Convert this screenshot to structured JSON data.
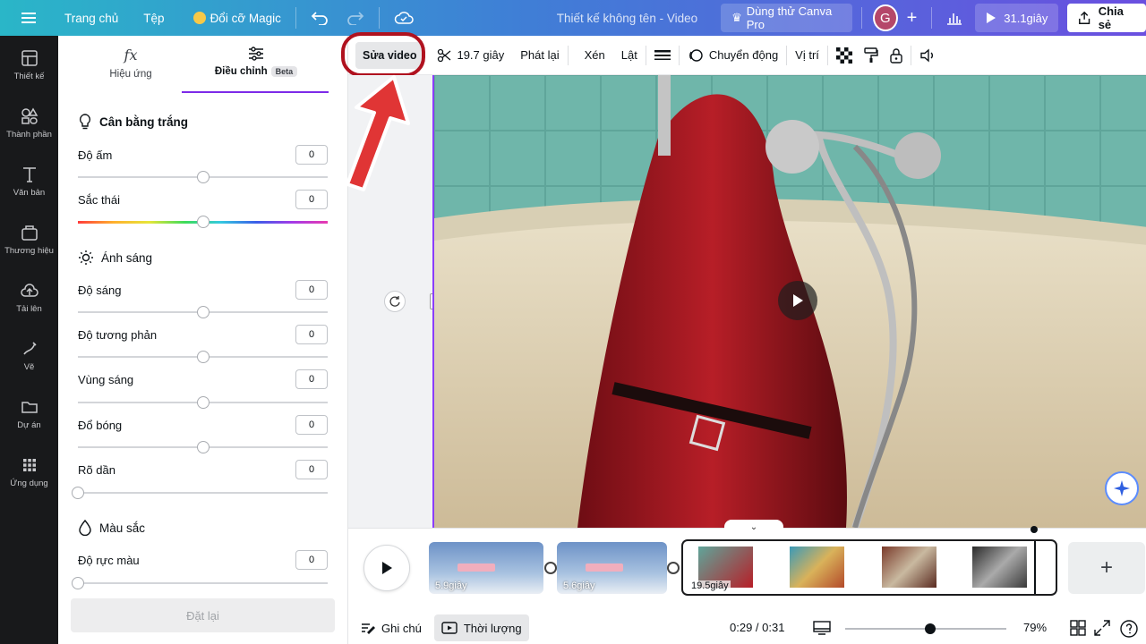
{
  "topbar": {
    "menu_icon": "hamburger-icon",
    "home": "Trang chủ",
    "file": "Tệp",
    "magic_resize": "Đổi cỡ Magic",
    "doc_title": "Thiết kế không tên - Video",
    "try_pro": "Dùng thử Canva Pro",
    "avatar_initial": "G",
    "play_duration": "31.1giây",
    "share": "Chia sẻ"
  },
  "rail": {
    "items": [
      {
        "label": "Thiết kế",
        "icon": "layout-icon"
      },
      {
        "label": "Thành phần",
        "icon": "shapes-icon"
      },
      {
        "label": "Văn bản",
        "icon": "text-icon"
      },
      {
        "label": "Thương hiệu",
        "icon": "brand-icon"
      },
      {
        "label": "Tải lên",
        "icon": "upload-icon"
      },
      {
        "label": "Vẽ",
        "icon": "draw-icon"
      },
      {
        "label": "Dự án",
        "icon": "folder-icon"
      },
      {
        "label": "Ứng dụng",
        "icon": "apps-icon"
      }
    ]
  },
  "panel": {
    "tab_effects": "Hiệu ứng",
    "tab_adjust": "Điều chỉnh",
    "beta": "Beta",
    "white_balance": {
      "title": "Cân bằng trắng",
      "warmth": {
        "label": "Độ ấm",
        "value": "0"
      },
      "tint": {
        "label": "Sắc thái",
        "value": "0"
      }
    },
    "light": {
      "title": "Ánh sáng",
      "brightness": {
        "label": "Độ sáng",
        "value": "0"
      },
      "contrast": {
        "label": "Độ tương phản",
        "value": "0"
      },
      "highlights": {
        "label": "Vùng sáng",
        "value": "0"
      },
      "shadows": {
        "label": "Đổ bóng",
        "value": "0"
      },
      "fade": {
        "label": "Rõ dần",
        "value": "0"
      }
    },
    "color": {
      "title": "Màu sắc",
      "vibrance": {
        "label": "Độ rực màu",
        "value": "0"
      }
    },
    "reset": "Đặt lại"
  },
  "toolbar": {
    "edit_video": "Sửa video",
    "duration": "19.7 giây",
    "playback": "Phát lại",
    "crop": "Xén",
    "flip": "Lật",
    "animate": "Chuyển động",
    "position": "Vị trí"
  },
  "timeline": {
    "clips": [
      {
        "label": "5.9giây"
      },
      {
        "label": "5.6giây"
      },
      {
        "label": "19.5giây"
      }
    ],
    "notes": "Ghi chú",
    "duration": "Thời lượng",
    "time": "0:29 / 0:31",
    "zoom": "79%",
    "zoom_fraction": 0.5
  },
  "colors": {
    "accent": "#7d2ae8",
    "highlight_annotation": "#b0121f"
  }
}
